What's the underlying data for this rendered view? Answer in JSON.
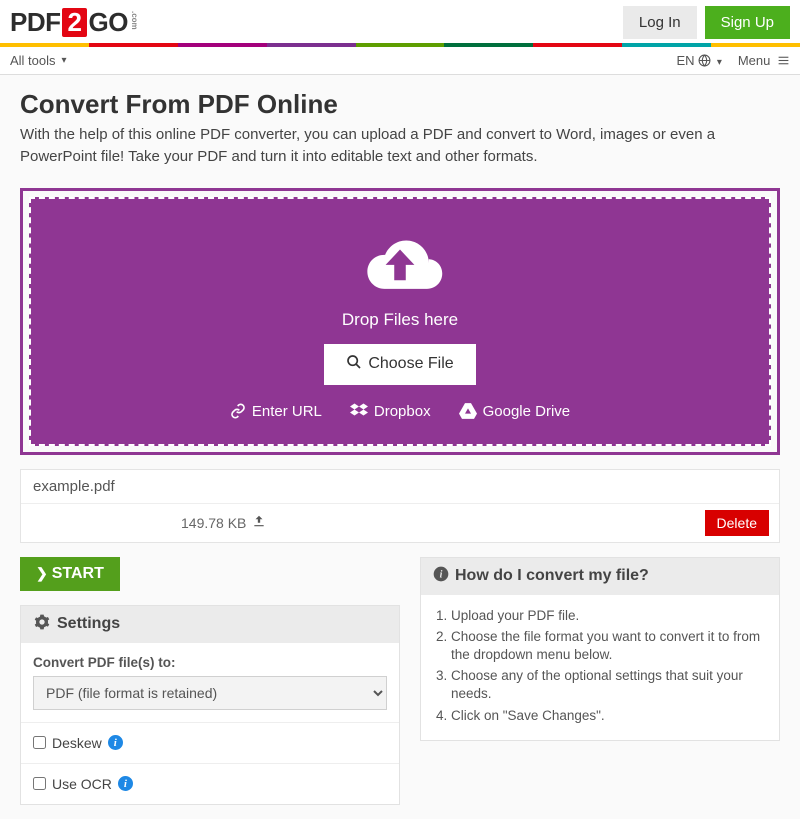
{
  "header": {
    "logo_pdf": "PDF",
    "logo_two": "2",
    "logo_go": "GO",
    "logo_com": ".com",
    "login": "Log In",
    "signup": "Sign Up"
  },
  "subnav": {
    "all_tools": "All tools",
    "lang": "EN",
    "menu": "Menu"
  },
  "page": {
    "title": "Convert From PDF Online",
    "subtitle": "With the help of this online PDF converter, you can upload a PDF and convert to Word, images or even a PowerPoint file! Take your PDF and turn it into editable text and other formats."
  },
  "dropzone": {
    "drop_text": "Drop Files here",
    "choose": "Choose File",
    "enter_url": "Enter URL",
    "dropbox": "Dropbox",
    "gdrive": "Google Drive"
  },
  "file": {
    "name": "example.pdf",
    "size": "149.78 KB",
    "delete": "Delete"
  },
  "start": "START",
  "settings": {
    "header": "Settings",
    "convert_to_label": "Convert PDF file(s) to:",
    "convert_to_value": "PDF (file format is retained)",
    "deskew": "Deskew",
    "use_ocr": "Use OCR"
  },
  "help": {
    "header": "How do I convert my file?",
    "steps": [
      "Upload your PDF file.",
      "Choose the file format you want to convert it to from the dropdown menu below.",
      "Choose any of the optional settings that suit your needs.",
      "Click on \"Save Changes\"."
    ]
  }
}
